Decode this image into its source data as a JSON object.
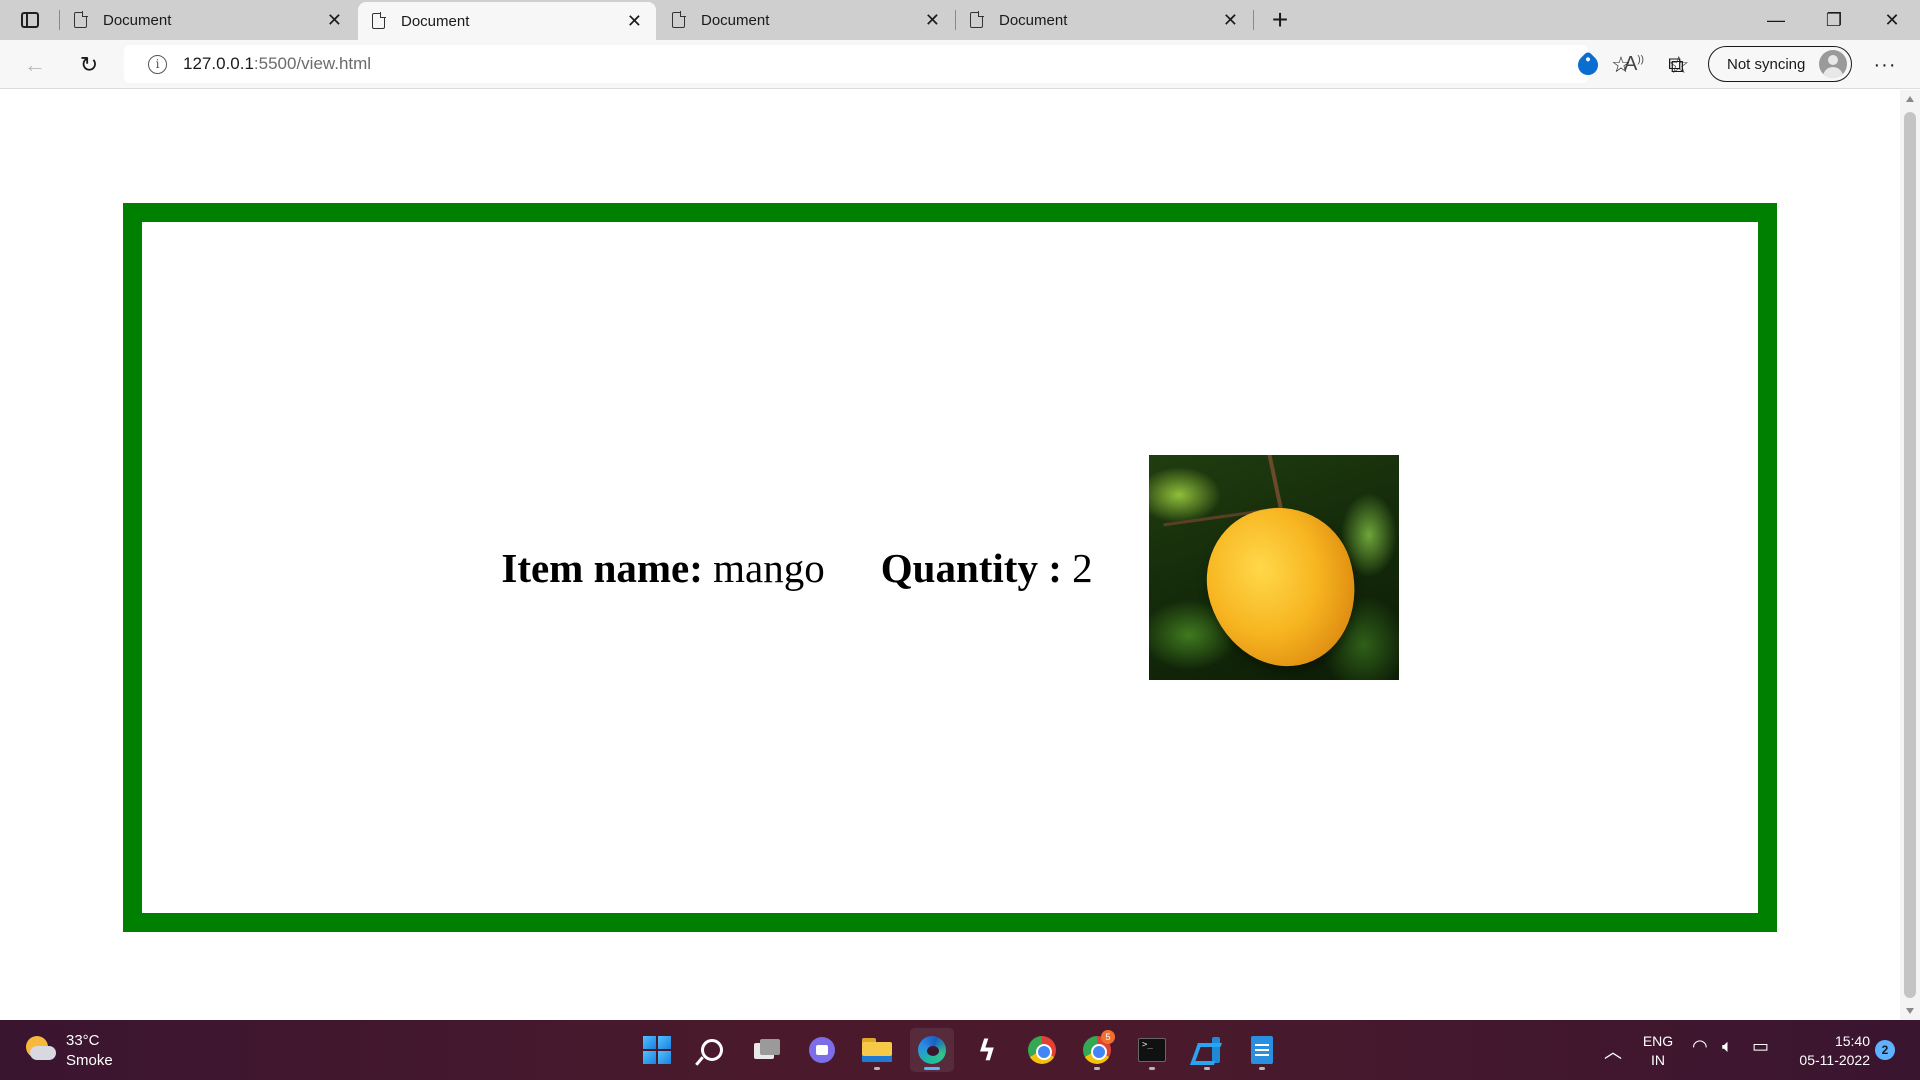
{
  "browser": {
    "tabs": [
      {
        "title": "Document",
        "active": false
      },
      {
        "title": "Document",
        "active": true
      },
      {
        "title": "Document",
        "active": false
      },
      {
        "title": "Document",
        "active": false
      }
    ],
    "tab_close_glyph": "✕",
    "new_tab_glyph": "+",
    "window_controls": {
      "minimize": "—",
      "restore": "❐",
      "close": "✕"
    },
    "address_bar": {
      "url_host": "127.0.0.1",
      "url_path": ":5500/view.html"
    },
    "sync_button_label": "Not syncing",
    "more_glyph": "···",
    "icons": {
      "back": "arrow-left-icon",
      "refresh": "refresh-icon",
      "info": "info-icon",
      "tag": "shopping-tag-icon",
      "read_aloud": "read-aloud-icon",
      "add_favorite": "add-favorite-icon",
      "favorites": "favorites-icon",
      "collections": "collections-icon",
      "profile": "profile-avatar-icon"
    }
  },
  "page": {
    "border_color": "#008000",
    "item_name_label": "Item name:",
    "item_name_value": "mango",
    "quantity_label": "Quantity :",
    "quantity_value": "2",
    "image_subject": "mango-photo"
  },
  "taskbar": {
    "weather": {
      "temperature": "33°C",
      "condition": "Smoke"
    },
    "apps": [
      "start",
      "search",
      "task-view",
      "teams-chat",
      "file-explorer",
      "edge",
      "bolt-app",
      "chrome",
      "chrome-profile",
      "terminal",
      "vscode",
      "notepad"
    ],
    "chrome_badge": "5",
    "tray": {
      "language_line1": "ENG",
      "language_line2": "IN",
      "time": "15:40",
      "date": "05-11-2022",
      "notification_count": "2"
    }
  }
}
